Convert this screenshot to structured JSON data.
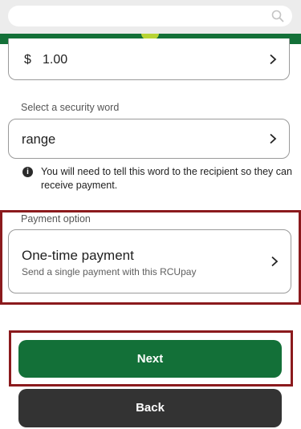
{
  "header": {
    "search_icon": "search-icon",
    "brand_color": "#137038"
  },
  "amount": {
    "currency": "$",
    "value": "1.00"
  },
  "security_word": {
    "label": "Select a security word",
    "value": "range",
    "info_text": "You will need to tell this word to the recipient so they can receive payment."
  },
  "payment_option": {
    "label": "Payment option",
    "title": "One-time payment",
    "subtitle": "Send a single payment with this RCUpay"
  },
  "actions": {
    "next_label": "Next",
    "back_label": "Back"
  },
  "colors": {
    "primary": "#137038",
    "secondary": "#333333",
    "highlight": "#8b1a1d"
  }
}
